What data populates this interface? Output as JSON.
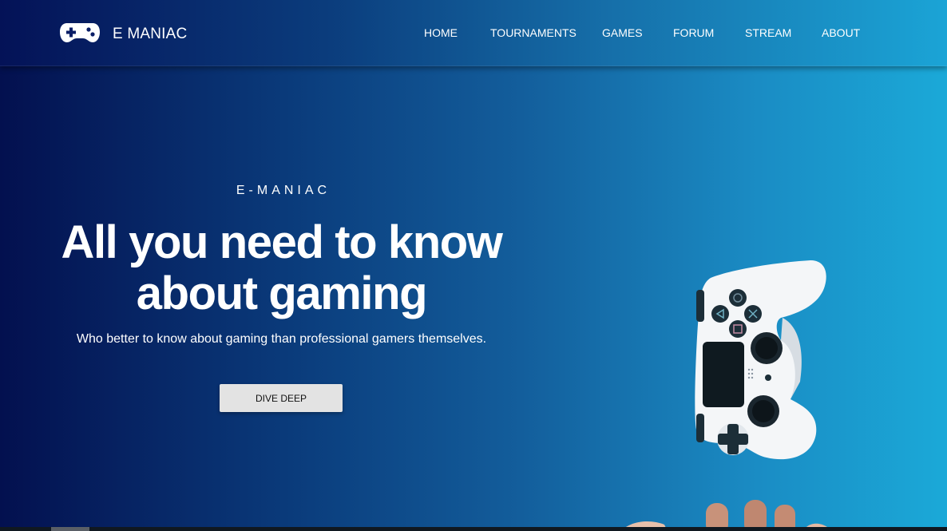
{
  "nav": {
    "brand": "E MANIAC",
    "brand_icon": "gamepad-icon",
    "links": [
      "HOME",
      "TOURNAMENTS",
      "GAMES",
      "FORUM",
      "STREAM",
      "ABOUT"
    ]
  },
  "hero": {
    "eyebrow": "E-MANIAC",
    "headline_line1": "All you need to know",
    "headline_line2": "about gaming",
    "subtext": "Who better to know about gaming than professional gamers themselves.",
    "cta_label": "DIVE DEEP",
    "image": "game-controller-image"
  },
  "colors": {
    "gradient_start": "#03104f",
    "gradient_end": "#1ba9d8",
    "button_bg": "#e3e3e3",
    "text": "#ffffff"
  }
}
